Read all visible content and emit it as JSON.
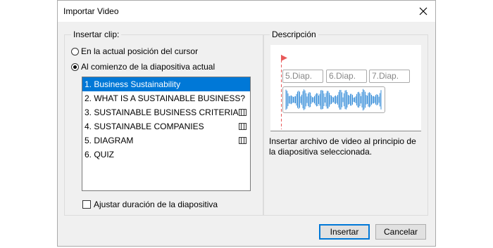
{
  "dialog": {
    "title": "Importar Video"
  },
  "insert_group": {
    "label": "Insertar clip:",
    "options": [
      {
        "label": "En la actual posición del cursor",
        "checked": false
      },
      {
        "label": "Al comienzo de la diapositiva actual",
        "checked": true
      }
    ],
    "slides": [
      {
        "label": "1. Business Sustainability",
        "selected": true,
        "has_video": false
      },
      {
        "label": "2. WHAT IS A SUSTAINABLE BUSINESS?",
        "selected": false,
        "has_video": false
      },
      {
        "label": "3. SUSTAINABLE BUSINESS CRITERIA",
        "selected": false,
        "has_video": true
      },
      {
        "label": "4. SUSTAINABLE COMPANIES",
        "selected": false,
        "has_video": true
      },
      {
        "label": "5. DIAGRAM",
        "selected": false,
        "has_video": true
      },
      {
        "label": "6. QUIZ",
        "selected": false,
        "has_video": false
      }
    ],
    "adjust_duration_label": "Ajustar duración de la diapositiva",
    "adjust_duration_checked": false
  },
  "description_group": {
    "label": "Descripción",
    "preview_slides": [
      "5.Diap.",
      "6.Diap.",
      "7.Diap."
    ],
    "text": "Insertar archivo de video al principio de la diapositiva seleccionada."
  },
  "buttons": {
    "insert": "Insertar",
    "cancel": "Cancelar"
  },
  "colors": {
    "selection": "#0078d7",
    "marker": "#e85a5a",
    "waveform": "#3a8fd9"
  }
}
